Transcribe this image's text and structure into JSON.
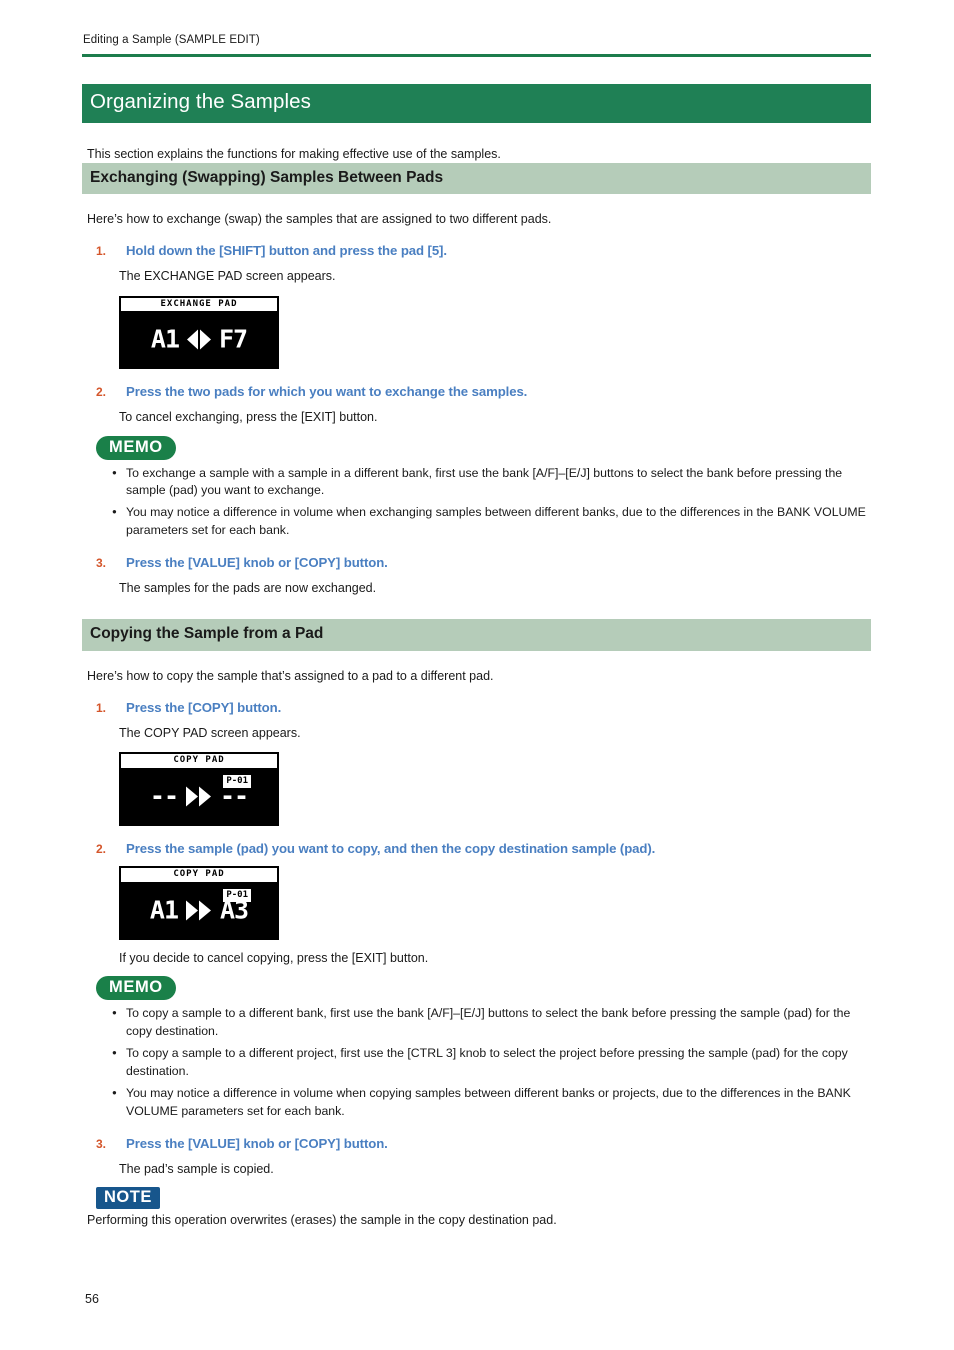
{
  "header": {
    "running_head": "Editing a Sample (SAMPLE EDIT)"
  },
  "chapter": {
    "title": "Organizing the Samples",
    "intro": "This section explains the functions for making effective use of the samples."
  },
  "sections": [
    {
      "heading": "Exchanging (Swapping) Samples Between Pads",
      "intro": "Here’s how to exchange (swap) the samples that are assigned to two different pads.",
      "steps": [
        {
          "number": "1.",
          "title": "Hold down the [SHIFT] button and press the pad [5].",
          "body": "The EXCHANGE PAD screen appears."
        },
        {
          "number": "2.",
          "title": "Press the two pads for which you want to exchange the samples.",
          "body": "To cancel exchanging, press the [EXIT] button."
        },
        {
          "number": "3.",
          "title": "Press the [VALUE] knob or [COPY] button.",
          "body": "The samples for the pads are now exchanged."
        }
      ],
      "lcd": {
        "title": "EXCHANGE PAD",
        "left": "A1",
        "right": "F7",
        "arrow": "double-headed-arrow-icon",
        "badge": ""
      },
      "memo": {
        "label": "MEMO",
        "bullets": [
          "To exchange a sample with a sample in a different bank, first use the bank [A/F]–[E/J] buttons to select the bank before pressing the sample (pad) you want to exchange.",
          "You may notice a difference in volume when exchanging samples between different banks, due to the differences in the BANK VOLUME parameters set for each bank."
        ]
      }
    },
    {
      "heading": "Copying the Sample from a Pad",
      "intro": "Here’s how to copy the sample that’s assigned to a pad to a different pad.",
      "steps": [
        {
          "number": "1.",
          "title": "Press the [COPY] button.",
          "body": "The COPY PAD screen appears."
        },
        {
          "number": "2.",
          "title": "Press the sample (pad) you want to copy, and then the copy destination sample (pad).",
          "body": "If you decide to cancel copying, press the [EXIT] button."
        },
        {
          "number": "3.",
          "title": "Press the [VALUE] knob or [COPY] button.",
          "body": "The pad’s sample is copied."
        }
      ],
      "lcd_empty": {
        "title": "COPY PAD",
        "left": "--",
        "right": "--",
        "arrow": "fast-forward-icon",
        "badge": "P-01"
      },
      "lcd_filled": {
        "title": "COPY PAD",
        "left": "A1",
        "right": "A3",
        "arrow": "fast-forward-icon",
        "badge": "P-01"
      },
      "memo": {
        "label": "MEMO",
        "bullets": [
          "To copy a sample to a different bank, first use the bank [A/F]–[E/J] buttons to select the bank before pressing the sample (pad) for the copy destination.",
          "To copy a sample to a different project, first use the [CTRL 3] knob to select the project before pressing the sample (pad) for the copy destination.",
          "You may notice a difference in volume when copying samples between different banks or projects, due to the differences in the BANK VOLUME parameters set for each bank."
        ]
      },
      "note": {
        "label": "NOTE",
        "text": "Performing this operation overwrites (erases) the sample in the copy destination pad."
      }
    }
  ],
  "footer": {
    "page_number": "56"
  },
  "colors": {
    "chapter_green": "#1f8055",
    "section_green": "#b5ccb9",
    "rule_green": "#1c7c4c",
    "memo_green": "#1a8049",
    "note_blue": "#17568c",
    "step_number_orange": "#d4552a",
    "step_title_blue": "#4a7fc1"
  }
}
